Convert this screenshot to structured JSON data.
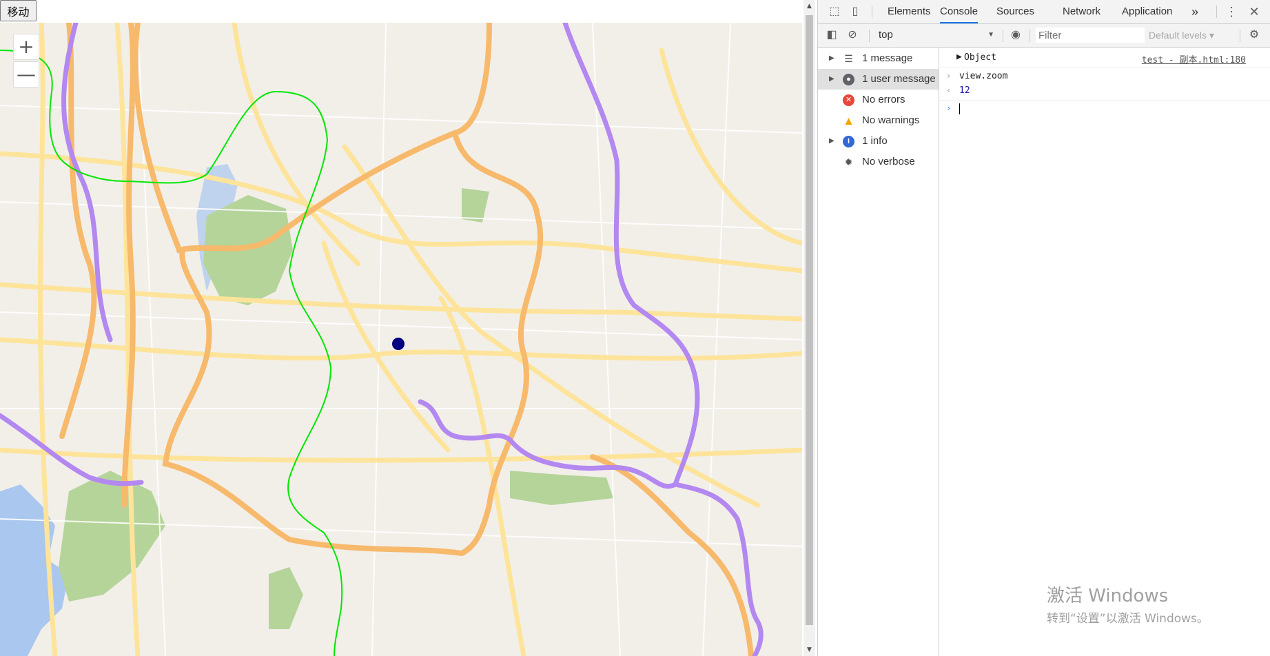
{
  "page": {
    "move_button_label": "移动",
    "map": {
      "zoom_in_label": "+",
      "zoom_out_label": "—",
      "marker_color": "#000080",
      "route_colors": {
        "green_line": "#00e600",
        "purple_line": "#b388f0",
        "orange_roads": "#f7b96b",
        "yellow_roads": "#fde49a",
        "water": "#a9c7ef",
        "park": "#b5d49a"
      }
    }
  },
  "devtools": {
    "tabs": [
      {
        "label": "Elements",
        "active": false
      },
      {
        "label": "Console",
        "active": true
      },
      {
        "label": "Sources",
        "active": false
      },
      {
        "label": "Network",
        "active": false
      },
      {
        "label": "Application",
        "active": false
      }
    ],
    "more_tabs_label": "»",
    "toolbar": {
      "context": "top",
      "filter_placeholder": "Filter",
      "levels_label": "Default levels ▾"
    },
    "sidebar": {
      "items": [
        {
          "label": "1 message",
          "icon": "list-icon",
          "expandable": true,
          "selected": false
        },
        {
          "label": "1 user message",
          "icon": "user-icon",
          "expandable": true,
          "selected": true
        },
        {
          "label": "No errors",
          "icon": "error-icon",
          "expandable": false,
          "selected": false
        },
        {
          "label": "No warnings",
          "icon": "warning-icon",
          "expandable": false,
          "selected": false
        },
        {
          "label": "1 info",
          "icon": "info-icon",
          "expandable": true,
          "selected": false
        },
        {
          "label": "No verbose",
          "icon": "bug-icon",
          "expandable": false,
          "selected": false
        }
      ]
    },
    "console": {
      "object_label": "Object",
      "object_source": "test - 副本.html:180",
      "command": "view.zoom",
      "result": "12"
    }
  },
  "watermark": {
    "line1": "激活 Windows",
    "line2": "转到“设置”以激活 Windows。"
  }
}
